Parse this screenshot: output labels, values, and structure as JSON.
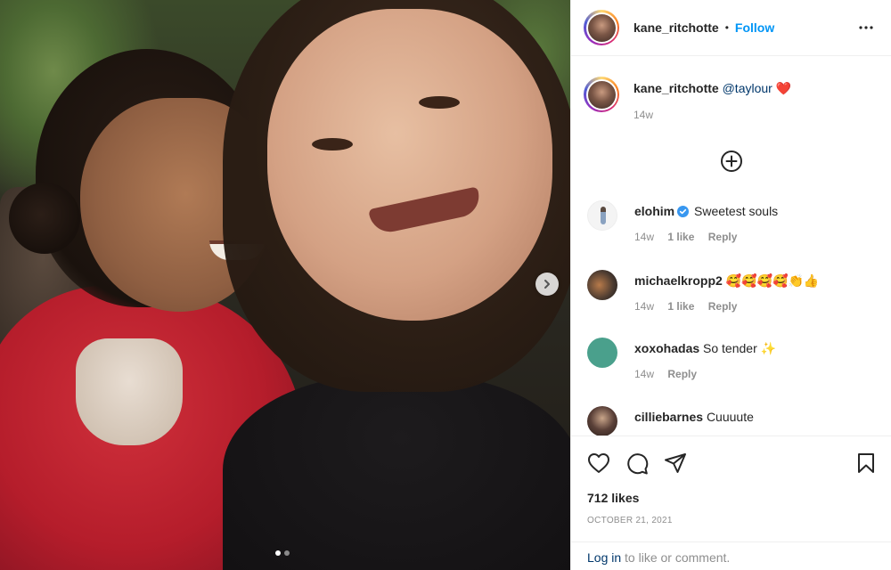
{
  "post": {
    "username": "kane_ritchotte",
    "separator": "•",
    "follow_label": "Follow",
    "caption": {
      "mention": "@taylour",
      "emoji": "❤️",
      "time": "14w"
    },
    "load_more_icon": "plus-circle-icon",
    "image_dots": 2,
    "active_dot": 0
  },
  "comments": [
    {
      "username": "elohim",
      "verified": true,
      "text": "Sweetest souls",
      "time": "14w",
      "likes": "1 like",
      "reply": "Reply"
    },
    {
      "username": "michaelkropp2",
      "verified": false,
      "text": "🥰🥰🥰🥰👏👍",
      "time": "14w",
      "likes": "1 like",
      "reply": "Reply"
    },
    {
      "username": "xoxohadas",
      "verified": false,
      "text": "So tender ✨",
      "time": "14w",
      "likes": "",
      "reply": "Reply"
    },
    {
      "username": "cilliebarnes",
      "verified": false,
      "text": "Cuuuute",
      "time": "",
      "likes": "",
      "reply": ""
    }
  ],
  "actions": {
    "likes": "712 likes",
    "date": "OCTOBER 21, 2021",
    "login_link": "Log in",
    "login_rest": " to like or comment."
  },
  "colors": {
    "link_blue": "#0095f6",
    "mention_blue": "#00376b",
    "muted": "#8e8e8e",
    "heart_red": "#ed4956"
  }
}
